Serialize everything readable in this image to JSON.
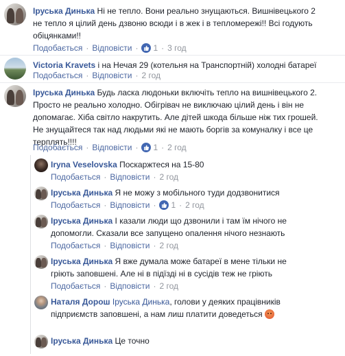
{
  "actions": {
    "like": "Подобається",
    "reply": "Відповісти"
  },
  "comments": [
    {
      "author": "Іруська Динька",
      "lines": [
        "Ні не тепло. Вони реально знущаються. Вишнівецького 2",
        "не тепло я цілий день дзвоню всюди і в жек і в тепломережі!! Всі годують",
        "обіцянками!!"
      ],
      "likes": "1",
      "time": "3 год"
    },
    {
      "author": "Victoria Kravets",
      "lines": [
        "і на Нечая 29 (котельня на Транспортній) холодні батареї"
      ],
      "time": "2 год"
    },
    {
      "author": "Іруська Динька",
      "lines": [
        "Будь ласка людоньки включіть тепло на вишнівецького 2.",
        "Просто не реально холодно. Обігрівач не виключаю цілий день і він не",
        "допомагає. Хіба світло накрутить. Але дітей шкода більше ніж тих грошей.",
        "Не знущайтеся так над людьми які не мають боргів за комуналку і все це",
        "терплять!!!!"
      ],
      "likes": "1",
      "time": "2 год"
    }
  ],
  "replies": [
    {
      "author": "Iryna Veselovska",
      "lines": [
        "Поскаржтеся на 15-80"
      ],
      "time": "2 год"
    },
    {
      "author": "Іруська Динька",
      "lines": [
        "Я не можу з мобільного туди додзвонитися"
      ],
      "likes": "1",
      "time": "2 год"
    },
    {
      "author": "Іруська Динька",
      "lines": [
        "І казали люди що дзвонили і там їм нічого не",
        "допомогли. Сказали все запущено опалення нічого незнають"
      ],
      "time": "2 год"
    },
    {
      "author": "Іруська Динька",
      "lines": [
        "Я вже думала може батареї в мене тільки не",
        "гріють заповшені. Але ні в підїзді ні в сусідів теж не гріють"
      ],
      "time": "2 год"
    },
    {
      "author": "Наталя Дорош",
      "tag": "Іруська Динька",
      "lines": [
        ", голови у деяких працівників",
        "підприємств заповшені, а нам лиш платити доведеться"
      ],
      "time": ""
    },
    {
      "author": "Іруська Динька",
      "lines": [
        "Це точно"
      ],
      "time": ""
    }
  ]
}
